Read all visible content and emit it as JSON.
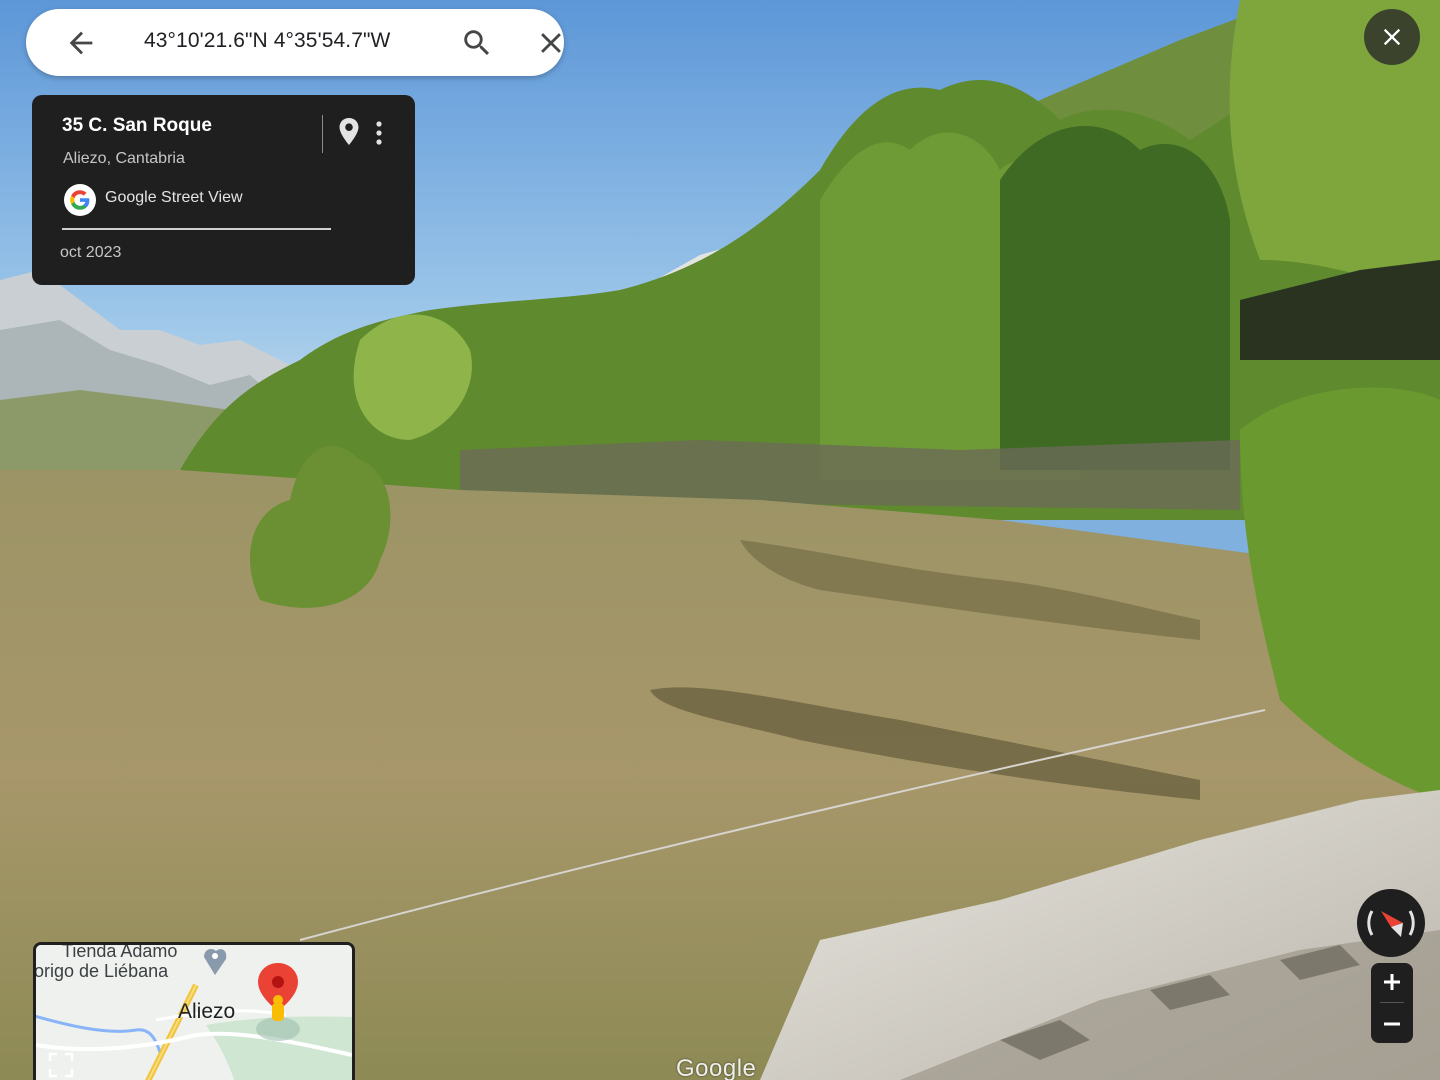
{
  "search": {
    "query": "43°10'21.6\"N 4°35'54.7\"W",
    "back_icon": "arrow-back-icon",
    "search_icon": "search-icon",
    "clear_icon": "close-icon"
  },
  "top_right": {
    "close_icon": "close-icon"
  },
  "info_card": {
    "address": "35 C. San Roque",
    "locality": "Aliezo, Cantabria",
    "source_label": "Google Street View",
    "date": "oct 2023",
    "pin_icon": "location-pin-icon",
    "more_icon": "more-vert-icon",
    "logo_icon": "google-g-logo"
  },
  "minimap": {
    "poi_label": "Tienda Adamo",
    "poi2_label": "lorigo de Liébana",
    "town_label": "Aliezo",
    "expand_icon": "expand-icon"
  },
  "controls": {
    "compass_icon": "compass-icon",
    "zoom_in_icon": "plus-icon",
    "zoom_out_icon": "minus-icon"
  },
  "watermark": "Google",
  "colors": {
    "card_bg": "#1f1f1f",
    "sky": "#7fb0de",
    "grass": "#a99a6c",
    "pin_red": "#ea4335"
  }
}
